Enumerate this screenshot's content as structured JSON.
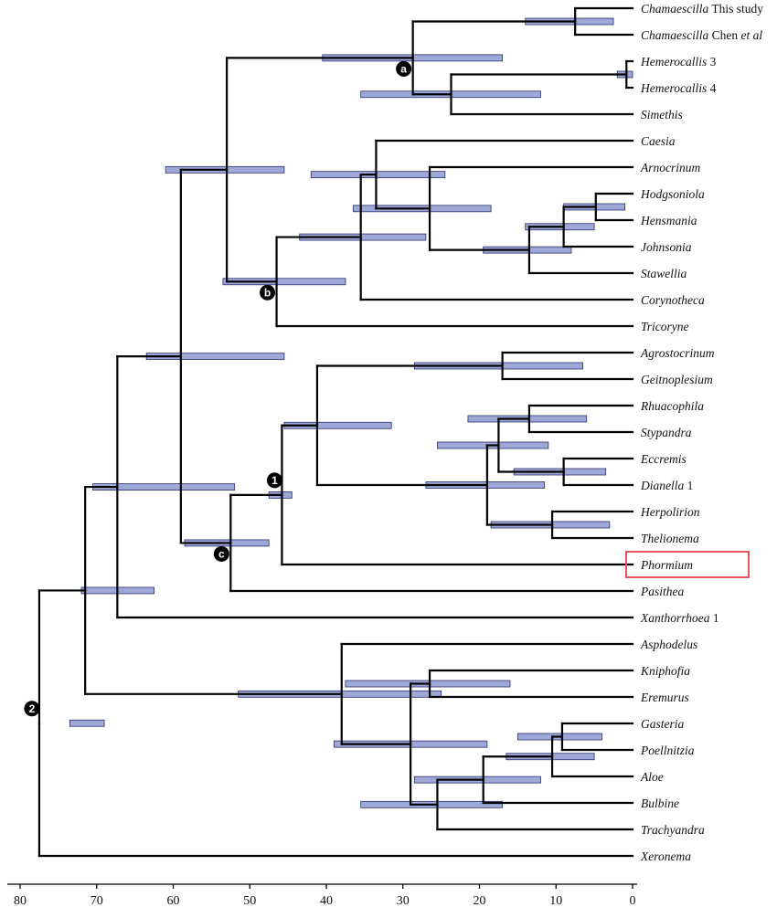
{
  "tree": {
    "tips": [
      {
        "id": "t1",
        "name": "Chamaescilla",
        "suffix": " This study"
      },
      {
        "id": "t2",
        "name": "Chamaescilla",
        "suffix": " Chen et al",
        "suffix_italic": true
      },
      {
        "id": "t3",
        "name": "Hemerocallis",
        "suffix": " 3"
      },
      {
        "id": "t4",
        "name": "Hemerocallis",
        "suffix": " 4"
      },
      {
        "id": "t5",
        "name": "Simethis",
        "suffix": ""
      },
      {
        "id": "t6",
        "name": "Caesia",
        "suffix": ""
      },
      {
        "id": "t7",
        "name": "Arnocrinum",
        "suffix": ""
      },
      {
        "id": "t8",
        "name": "Hodgsoniola",
        "suffix": ""
      },
      {
        "id": "t9",
        "name": "Hensmania",
        "suffix": ""
      },
      {
        "id": "t10",
        "name": "Johnsonia",
        "suffix": ""
      },
      {
        "id": "t11",
        "name": "Stawellia",
        "suffix": ""
      },
      {
        "id": "t12",
        "name": "Corynotheca",
        "suffix": ""
      },
      {
        "id": "t13",
        "name": "Tricoryne",
        "suffix": ""
      },
      {
        "id": "t14",
        "name": "Agrostocrinum",
        "suffix": ""
      },
      {
        "id": "t15",
        "name": "Geitnoplesium",
        "suffix": ""
      },
      {
        "id": "t16",
        "name": "Rhuacophila",
        "suffix": ""
      },
      {
        "id": "t17",
        "name": "Stypandra",
        "suffix": ""
      },
      {
        "id": "t18",
        "name": "Eccremis",
        "suffix": ""
      },
      {
        "id": "t19",
        "name": "Dianella",
        "suffix": " 1"
      },
      {
        "id": "t20",
        "name": "Herpolirion",
        "suffix": ""
      },
      {
        "id": "t21",
        "name": "Thelionema",
        "suffix": ""
      },
      {
        "id": "t22",
        "name": "Phormium",
        "suffix": "",
        "highlight": true
      },
      {
        "id": "t23",
        "name": "Pasithea",
        "suffix": ""
      },
      {
        "id": "t24",
        "name": "Xanthorrhoea",
        "suffix": " 1"
      },
      {
        "id": "t25",
        "name": "Asphodelus",
        "suffix": ""
      },
      {
        "id": "t26",
        "name": "Kniphofia",
        "suffix": ""
      },
      {
        "id": "t27",
        "name": "Eremurus",
        "suffix": ""
      },
      {
        "id": "t28",
        "name": "Gasteria",
        "suffix": ""
      },
      {
        "id": "t29",
        "name": "Poellnitzia",
        "suffix": ""
      },
      {
        "id": "t30",
        "name": "Aloe",
        "suffix": ""
      },
      {
        "id": "t31",
        "name": "Bulbine",
        "suffix": ""
      },
      {
        "id": "t32",
        "name": "Trachyandra",
        "suffix": ""
      },
      {
        "id": "t33",
        "name": "Xeronema",
        "suffix": ""
      }
    ],
    "nodes": [
      {
        "id": "n1",
        "age": 7.5,
        "children": [
          "t1",
          "t2"
        ],
        "hpd": [
          14,
          2.5
        ]
      },
      {
        "id": "n2",
        "age": 0.8,
        "children": [
          "t3",
          "t4"
        ],
        "hpd": [
          2,
          0
        ]
      },
      {
        "id": "n3",
        "age": 23.7,
        "children": [
          "n2",
          "t5"
        ],
        "hpd": [
          35.5,
          12
        ]
      },
      {
        "id": "n4",
        "age": 28.7,
        "children": [
          "n1",
          "n3"
        ],
        "hpd": [
          40.5,
          17
        ],
        "label": "a"
      },
      {
        "id": "n5",
        "age": 4.8,
        "children": [
          "t8",
          "t9"
        ],
        "hpd": [
          9,
          1
        ]
      },
      {
        "id": "n6",
        "age": 9,
        "children": [
          "n5",
          "t10"
        ],
        "hpd": [
          14,
          5
        ]
      },
      {
        "id": "n7",
        "age": 13.5,
        "children": [
          "n6",
          "t11"
        ],
        "hpd": [
          19.5,
          8
        ]
      },
      {
        "id": "n8",
        "age": 26.5,
        "children": [
          "t7",
          "n7"
        ],
        "hpd": [
          36.5,
          18.5
        ]
      },
      {
        "id": "n9",
        "age": 33.5,
        "children": [
          "t6",
          "n8"
        ],
        "hpd": [
          42,
          24.5
        ]
      },
      {
        "id": "n10",
        "age": 35.5,
        "children": [
          "n9",
          "t12"
        ],
        "hpd": [
          43.5,
          27
        ]
      },
      {
        "id": "n11",
        "age": 46.5,
        "children": [
          "n10",
          "t13"
        ],
        "hpd": [
          53.5,
          37.5
        ],
        "label": "b"
      },
      {
        "id": "n12",
        "age": 53,
        "children": [
          "n4",
          "n11"
        ],
        "hpd": [
          61,
          45.5
        ]
      },
      {
        "id": "n13",
        "age": 17,
        "children": [
          "t14",
          "t15"
        ],
        "hpd": [
          28.5,
          6.5
        ]
      },
      {
        "id": "n14",
        "age": 13.5,
        "children": [
          "t16",
          "t17"
        ],
        "hpd": [
          21.5,
          6
        ]
      },
      {
        "id": "n15",
        "age": 9,
        "children": [
          "t18",
          "t19"
        ],
        "hpd": [
          15.5,
          3.5
        ]
      },
      {
        "id": "n16",
        "age": 17.5,
        "children": [
          "n14",
          "n15"
        ],
        "hpd": [
          25.5,
          11
        ]
      },
      {
        "id": "n17",
        "age": 10.5,
        "children": [
          "t20",
          "t21"
        ],
        "hpd": [
          18.5,
          3
        ]
      },
      {
        "id": "n18",
        "age": 19,
        "children": [
          "n16",
          "n17"
        ],
        "hpd": [
          27,
          11.5
        ]
      },
      {
        "id": "n19",
        "age": 41.2,
        "children": [
          "n13",
          "n18"
        ],
        "hpd": [
          45.5,
          31.5
        ]
      },
      {
        "id": "n20",
        "age": 45.8,
        "children": [
          "n19",
          "t22"
        ],
        "hpd": [
          47.5,
          44.5
        ],
        "label": "1"
      },
      {
        "id": "n21",
        "age": 52.5,
        "children": [
          "n20",
          "t23"
        ],
        "hpd": [
          58.5,
          47.5
        ],
        "label": "c"
      },
      {
        "id": "n22",
        "age": 59,
        "children": [
          "n12",
          "n21"
        ],
        "hpd": [
          63.5,
          45.5
        ]
      },
      {
        "id": "n23",
        "age": 67.3,
        "children": [
          "n22",
          "t24"
        ],
        "hpd": [
          70.5,
          52
        ]
      },
      {
        "id": "n24",
        "age": 26.5,
        "children": [
          "t26",
          "t27"
        ],
        "hpd": [
          37.5,
          16
        ]
      },
      {
        "id": "n25",
        "age": 9.2,
        "children": [
          "t28",
          "t29"
        ],
        "hpd": [
          15,
          4
        ]
      },
      {
        "id": "n26",
        "age": 10.5,
        "children": [
          "n25",
          "t30"
        ],
        "hpd": [
          16.5,
          5
        ]
      },
      {
        "id": "n27",
        "age": 19.5,
        "children": [
          "n26",
          "t31"
        ],
        "hpd": [
          28.5,
          12
        ]
      },
      {
        "id": "n28",
        "age": 25.5,
        "children": [
          "n27",
          "t32"
        ],
        "hpd": [
          35.5,
          17
        ]
      },
      {
        "id": "n29",
        "age": 29,
        "children": [
          "n24",
          "n28"
        ],
        "hpd": [
          39,
          19
        ]
      },
      {
        "id": "n30",
        "age": 38,
        "children": [
          "t25",
          "n29"
        ],
        "hpd": [
          51.5,
          25
        ]
      },
      {
        "id": "n31",
        "age": 71.5,
        "children": [
          "n23",
          "n30"
        ],
        "hpd": [
          72,
          62.5
        ]
      },
      {
        "id": "n32",
        "age": 77.5,
        "children": [
          "n31",
          "t33"
        ],
        "hpd": [
          73.5,
          69
        ],
        "label": "2"
      }
    ],
    "root": "n32"
  },
  "axis": {
    "ticks": [
      80,
      70,
      60,
      50,
      40,
      30,
      20,
      10,
      0
    ],
    "range": [
      80,
      0
    ]
  }
}
